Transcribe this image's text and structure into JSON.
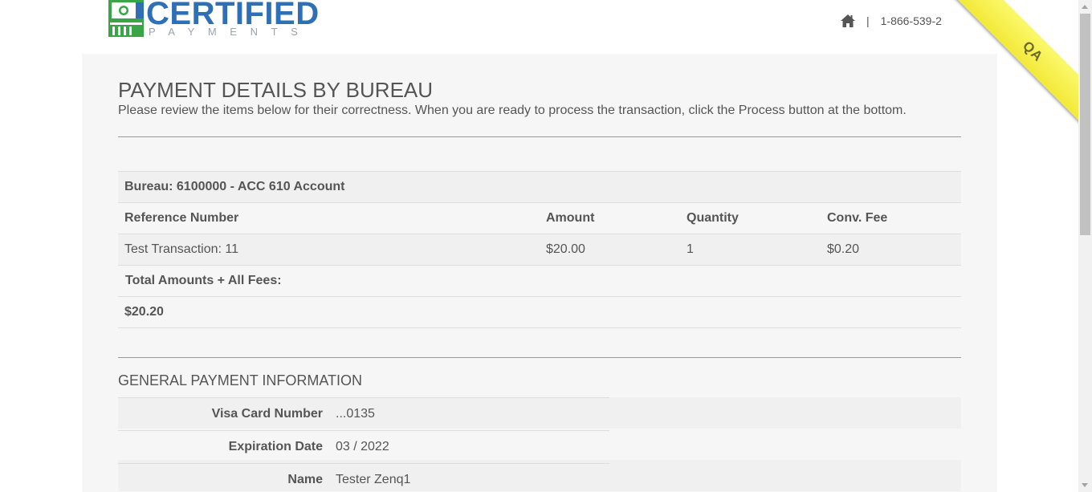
{
  "brand": {
    "name": "CERTIFIED",
    "tagline": "PAYMENTS",
    "colors": {
      "primary": "#2f6fb5",
      "accent": "#3aa548",
      "tagline": "#9aa4ad"
    }
  },
  "nav": {
    "home_icon": "home-icon",
    "separator": "|",
    "phone": "1-866-539-2"
  },
  "ribbon": {
    "label": "QA",
    "color": "#f7f542"
  },
  "page": {
    "title": "PAYMENT DETAILS BY BUREAU",
    "intro": "Please review the items below for their correctness. When you are ready to process the transaction, click the Process button at the bottom."
  },
  "bureau_table": {
    "bureau_label": "Bureau: 6100000 - ACC 610 Account",
    "columns": [
      "Reference Number",
      "Amount",
      "Quantity",
      "Conv. Fee"
    ],
    "rows": [
      {
        "reference": "Test Transaction: 11",
        "amount": "$20.00",
        "quantity": "1",
        "fee": "$0.20"
      }
    ],
    "total_label": "Total Amounts + All Fees:",
    "total_value": "$20.20"
  },
  "general_info": {
    "title": "GENERAL PAYMENT INFORMATION",
    "fields": [
      {
        "label": "Visa Card Number",
        "value": "...0135"
      },
      {
        "label": "Expiration Date",
        "value": "03 / 2022"
      },
      {
        "label": "Name",
        "value": "Tester Zenq1"
      }
    ]
  }
}
